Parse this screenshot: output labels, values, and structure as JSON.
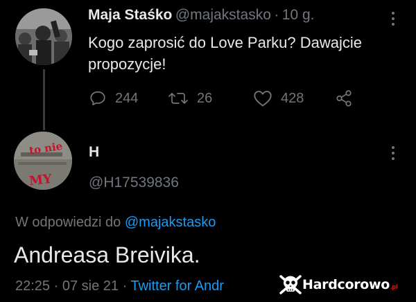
{
  "tweet": {
    "author_name": "Maja Staśko",
    "author_handle": "@majakstasko",
    "separator": "·",
    "time": "10 g.",
    "text_line1": "Kogo zaprosić do Love Parku? Dawajcie",
    "text_line2": "propozycje!",
    "replies": "244",
    "retweets": "26",
    "likes": "428"
  },
  "reply": {
    "author_name": "H",
    "author_handle": "@H17539836",
    "avatar_text_top": "to nie",
    "avatar_text_bottom": "MY",
    "in_reply_prefix": "W odpowiedzi do",
    "in_reply_handle": "@majakstasko",
    "text": "Andreasa Breivika.",
    "time": "22:25",
    "date": "07 sie 21",
    "separator": "·",
    "source": "Twitter for Andr"
  },
  "watermark": {
    "brand": "Hardcorowo",
    "tld": ".pl"
  },
  "colors": {
    "background": "#000000",
    "primary_text": "#e7e9ea",
    "secondary_text": "#71767b",
    "link": "#1d9bf0"
  }
}
